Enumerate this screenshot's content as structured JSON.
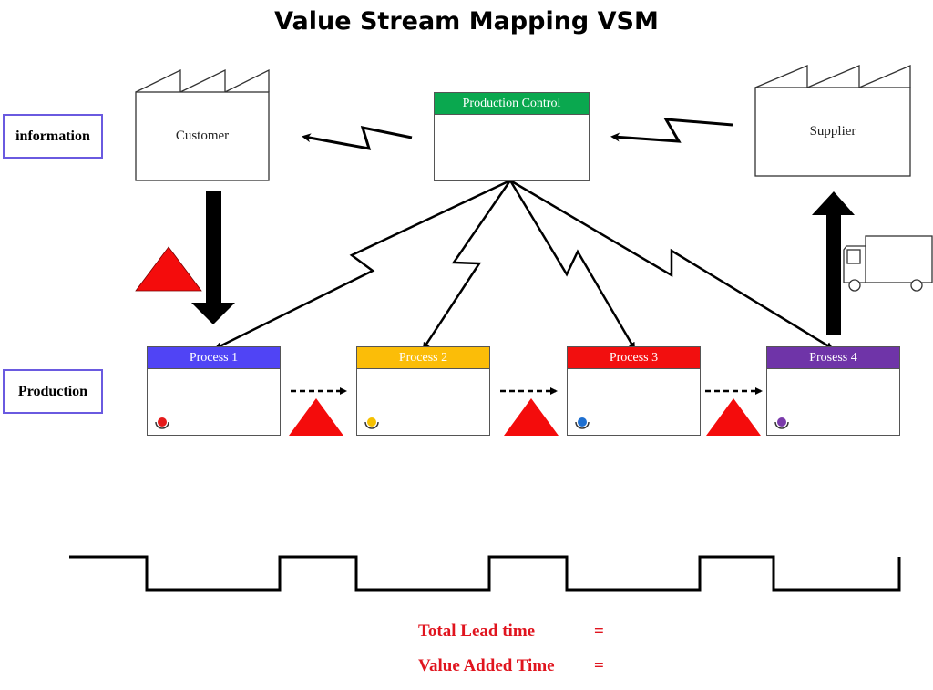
{
  "title": "Value Stream Mapping VSM",
  "row_labels": {
    "information": "information",
    "production": "Production"
  },
  "entities": {
    "customer": "Customer",
    "supplier": "Supplier",
    "production_control": {
      "label": "Production Control",
      "color": "#0aa84f"
    }
  },
  "processes": [
    {
      "label": "Process 1",
      "color": "#5044f5",
      "operator_color": "#e51b1b"
    },
    {
      "label": "Process 2",
      "color": "#fbbd08",
      "operator_color": "#f5c000"
    },
    {
      "label": "Process 3",
      "color": "#f20f0f",
      "operator_color": "#1e6fd0"
    },
    {
      "label": "Prosess 4",
      "color": "#6f34a8",
      "operator_color": "#7a3aaa"
    }
  ],
  "inventory_color": "#f40c0c",
  "timeline_pattern": [
    "up",
    "down",
    "up",
    "down",
    "up",
    "down",
    "up",
    "down"
  ],
  "summary": {
    "total_lead_time_label": "Total Lead time",
    "total_lead_time_value": "=",
    "value_added_time_label": "Value Added Time",
    "value_added_time_value": "="
  },
  "colors": {
    "label_border": "#6a5ae0",
    "summary_text": "#e0141e"
  }
}
